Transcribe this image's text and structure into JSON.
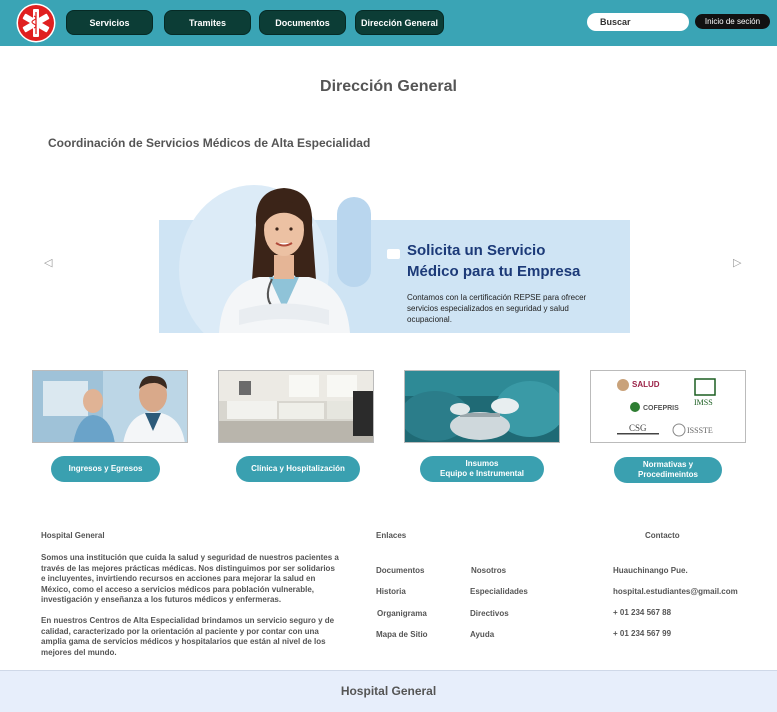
{
  "nav": {
    "items": [
      "Servicios",
      "Tramites",
      "Documentos",
      "Dirección General"
    ],
    "search_placeholder": "Buscar",
    "login_label": "Inicio de seción"
  },
  "page": {
    "title": "Dirección General",
    "subtitle": "Coordinación de Servicios Médicos de Alta Especialidad"
  },
  "banner": {
    "headline_line1": "Solicita un Servicio",
    "headline_line2": "Médico para tu Empresa",
    "body": "Contamos con la certificación REPSE para ofrecer servicios especializados en seguridad y salud ocupacional.",
    "prev_arrow": "◁",
    "next_arrow": "▷"
  },
  "cards": [
    {
      "line1": "Ingresos y Egresos",
      "line2": ""
    },
    {
      "line1": "Clínica y Hospitalización",
      "line2": ""
    },
    {
      "line1": "Insumos",
      "line2": "Equipo e Instrumental"
    },
    {
      "line1": "Normativas y",
      "line2": "Procedimeintos"
    }
  ],
  "logos": {
    "salud": "SALUD",
    "cofepris": "COFEPRIS",
    "imss": "IMSS",
    "csg": "CSG",
    "issste": "ISSSTE"
  },
  "footer": {
    "about_title": "Hospital General",
    "about_p1": "Somos una institución que cuida la salud y seguridad de nuestros pacientes a través de las mejores prácticas médicas. Nos distinguimos por ser solidarios e incluyentes, invirtiendo recursos en acciones para mejorar la salud en México, como el acceso a servicios médicos para población vulnerable, investigación y enseñanza a los futuros médicos y enfermeras.",
    "about_p2": "En nuestros Centros de Alta Especialidad brindamos un servicio seguro y de calidad, caracterizado por la orientación al paciente y por contar con una amplia gama de servicios médicos y hospitalarios que están al nivel de los mejores del mundo.",
    "links_title": "Enlaces",
    "links_col1": [
      "Documentos",
      "Historia",
      "Organigrama",
      "Mapa de Sitio"
    ],
    "links_col2": [
      "Nosotros",
      "Especialidades",
      "Directivos",
      "Ayuda"
    ],
    "contact_title": "Contacto",
    "contact": [
      "Huauchinango Pue.",
      "hospital.estudiantes@gmail.com",
      "+ 01 234 567 88",
      "+ 01 234 567 99"
    ],
    "bottom_title": "Hospital General"
  },
  "colors": {
    "navbar": "#3aa4b5",
    "nav_button": "#0c3d36",
    "card_button": "#3aa0b0",
    "banner_bg": "#cfe4f4",
    "banner_headline": "#1c3a78",
    "bottom_bar": "#e7eefb",
    "logo_red": "#e02020"
  }
}
